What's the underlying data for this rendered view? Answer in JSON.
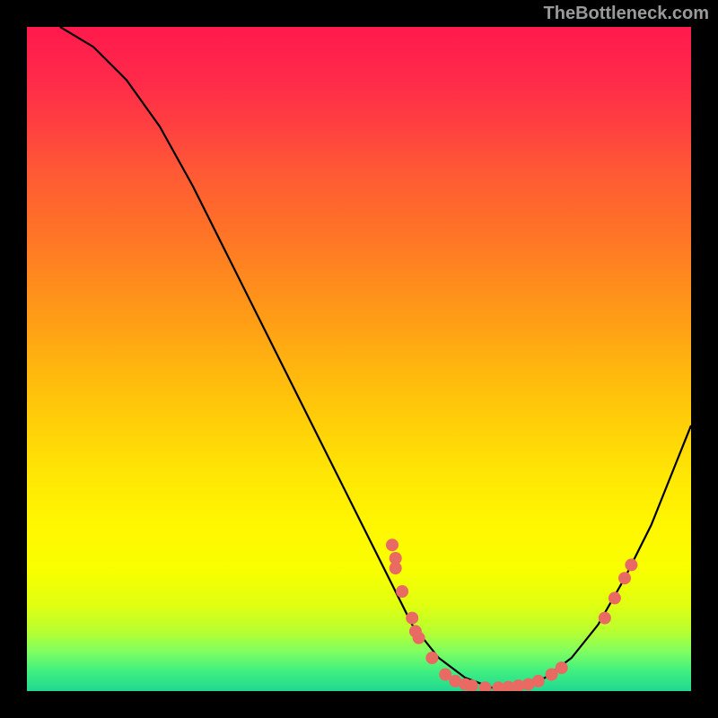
{
  "watermark": "TheBottleneck.com",
  "chart_data": {
    "type": "line",
    "title": "",
    "xlabel": "",
    "ylabel": "",
    "xlim": [
      0,
      100
    ],
    "ylim": [
      0,
      100
    ],
    "curve": {
      "x": [
        5,
        10,
        15,
        20,
        25,
        30,
        35,
        40,
        45,
        50,
        55,
        58,
        62,
        66,
        70,
        74,
        78,
        82,
        86,
        90,
        94,
        98,
        100
      ],
      "y": [
        100,
        97,
        92,
        85,
        76,
        66,
        56,
        46,
        36,
        26,
        16,
        10,
        5,
        2,
        0.5,
        0.5,
        2,
        5,
        10,
        17,
        25,
        35,
        40
      ]
    },
    "points": [
      {
        "x": 55,
        "y": 22
      },
      {
        "x": 55.5,
        "y": 20
      },
      {
        "x": 55.5,
        "y": 18.5
      },
      {
        "x": 56.5,
        "y": 15
      },
      {
        "x": 58,
        "y": 11
      },
      {
        "x": 58.5,
        "y": 9
      },
      {
        "x": 59,
        "y": 8
      },
      {
        "x": 61,
        "y": 5
      },
      {
        "x": 63,
        "y": 2.5
      },
      {
        "x": 64.5,
        "y": 1.5
      },
      {
        "x": 66,
        "y": 1
      },
      {
        "x": 67,
        "y": 0.8
      },
      {
        "x": 69,
        "y": 0.5
      },
      {
        "x": 71,
        "y": 0.5
      },
      {
        "x": 72.5,
        "y": 0.6
      },
      {
        "x": 74,
        "y": 0.8
      },
      {
        "x": 75.5,
        "y": 1
      },
      {
        "x": 77,
        "y": 1.5
      },
      {
        "x": 79,
        "y": 2.5
      },
      {
        "x": 80.5,
        "y": 3.5
      },
      {
        "x": 87,
        "y": 11
      },
      {
        "x": 88.5,
        "y": 14
      },
      {
        "x": 90,
        "y": 17
      },
      {
        "x": 91,
        "y": 19
      }
    ]
  }
}
